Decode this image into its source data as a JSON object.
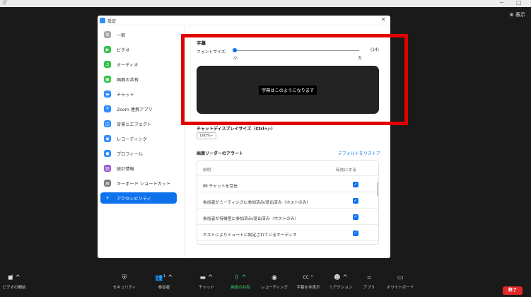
{
  "window": {
    "title_fragment": "グ",
    "minimize": "−",
    "maximize": "□",
    "view_button": "⊞ 表示"
  },
  "dialog": {
    "title": "設定",
    "close": "×"
  },
  "sidebar": {
    "items": [
      {
        "label": "一般",
        "icon_color": "#a8a8a8",
        "icon": "gear-icon"
      },
      {
        "label": "ビデオ",
        "icon_color": "#36c04a",
        "icon": "video-icon"
      },
      {
        "label": "オーディオ",
        "icon_color": "#36c04a",
        "icon": "headphone-icon"
      },
      {
        "label": "画面の共有",
        "icon_color": "#36c04a",
        "icon": "share-screen-icon"
      },
      {
        "label": "チャット",
        "icon_color": "#2d8cff",
        "icon": "chat-icon"
      },
      {
        "label": "Zoom 連携アプリ",
        "icon_color": "#2d8cff",
        "icon": "apps-icon"
      },
      {
        "label": "背景とエフェクト",
        "icon_color": "#2d8cff",
        "icon": "background-icon"
      },
      {
        "label": "レコーディング",
        "icon_color": "#2d8cff",
        "icon": "record-icon"
      },
      {
        "label": "プロフィール",
        "icon_color": "#2d8cff",
        "icon": "profile-icon"
      },
      {
        "label": "統計情報",
        "icon_color": "#9b59d0",
        "icon": "stats-icon"
      },
      {
        "label": "キーボード ショートカット",
        "icon_color": "#7a7a7a",
        "icon": "keyboard-icon"
      },
      {
        "label": "アクセシビリティ",
        "icon_color": "#ffffff",
        "icon": "accessibility-icon",
        "active": true
      }
    ]
  },
  "captions": {
    "heading": "字幕",
    "font_size_label": "フォントサイズ:",
    "font_size_value": "(14)",
    "small_label": "小",
    "large_label": "大",
    "slider_level": 0.0,
    "preview_text": "字幕はこのようになります"
  },
  "chat_display": {
    "heading": "チャットディスプレイサイズ（Ctrl+/-）",
    "zoom_value": "100%",
    "chevron": "⌄"
  },
  "screen_reader": {
    "heading": "画面リーダーのアラート",
    "reset_link": "デフォルトをリストア",
    "col_description": "説明",
    "col_enabled": "有効にする",
    "rows": [
      {
        "label": "IM チャットを受信",
        "checked": "✓"
      },
      {
        "label": "参加者がミーティングに参加済み/退出済み（ホストのみ）",
        "checked": "✓"
      },
      {
        "label": "参加者が待機室に参加済み/退出済み（ホストのみ）",
        "checked": "✓"
      },
      {
        "label": "ホストによりミュートに設定されているオーディオ",
        "checked": "✓"
      }
    ]
  },
  "toolbar": {
    "items": [
      {
        "label": "ビデオの開始",
        "icon": "video-off-icon",
        "glyph": "◼̸ ^"
      },
      {
        "label": "セキュリティ",
        "icon": "shield-icon",
        "glyph": "⛨"
      },
      {
        "label": "参加者",
        "icon": "participants-icon",
        "glyph": "👥¹ ^"
      },
      {
        "label": "チャット",
        "icon": "chat-bubble-icon",
        "glyph": "▬ ^"
      },
      {
        "label": "画面の共有",
        "icon": "share-icon",
        "glyph": "⇧ ^",
        "green": true
      },
      {
        "label": "レコーディング",
        "icon": "record-icon",
        "glyph": "◉"
      },
      {
        "label": "字幕を非表示",
        "icon": "cc-icon",
        "glyph": "CC ^"
      },
      {
        "label": "リアクション",
        "icon": "reaction-icon",
        "glyph": "☻ ^"
      },
      {
        "label": "アプリ",
        "icon": "apps-grid-icon",
        "glyph": "⌗"
      },
      {
        "label": "ホワイトボード",
        "icon": "whiteboard-icon",
        "glyph": "▭"
      }
    ],
    "end_label": "終了"
  }
}
